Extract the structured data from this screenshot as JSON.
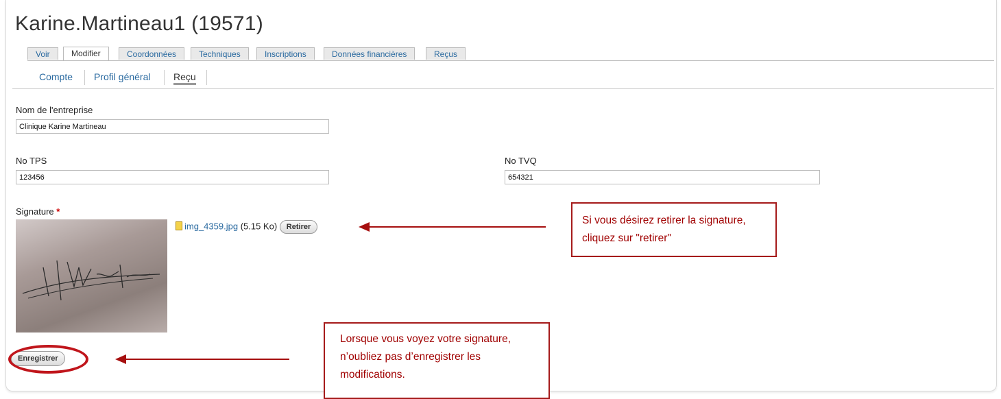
{
  "page": {
    "title": "Karine.Martineau1 (19571)"
  },
  "tabs": [
    {
      "label": "Voir",
      "active": false
    },
    {
      "label": "Modifier",
      "active": true
    },
    {
      "label": "Coordonnées",
      "active": false
    },
    {
      "label": "Techniques",
      "active": false
    },
    {
      "label": "Inscriptions",
      "active": false
    },
    {
      "label": "Données financières",
      "active": false
    },
    {
      "label": "Reçus",
      "active": false
    }
  ],
  "subtabs": [
    {
      "label": "Compte",
      "active": false
    },
    {
      "label": "Profil général",
      "active": false
    },
    {
      "label": "Reçu",
      "active": true
    }
  ],
  "form": {
    "company": {
      "label": "Nom de l'entreprise",
      "value": "Clinique Karine Martineau"
    },
    "tps": {
      "label": "No TPS",
      "value": "123456"
    },
    "tvq": {
      "label": "No TVQ",
      "value": "654321"
    },
    "signature": {
      "label": "Signature",
      "required_mark": "*",
      "file_name": "img_4359.jpg",
      "file_size": "(5.15 Ko)",
      "remove_label": "Retirer"
    },
    "save_label": "Enregistrer"
  },
  "callouts": {
    "remove": "Si vous désirez retirer la signature, cliquez sur \"retirer\"",
    "save": "Lorsque vous voyez votre signature, n’oubliez pas d’enregistrer  les modifications."
  },
  "colors": {
    "link": "#2a6aa0",
    "callout": "#a00000",
    "required": "#cc0000"
  }
}
